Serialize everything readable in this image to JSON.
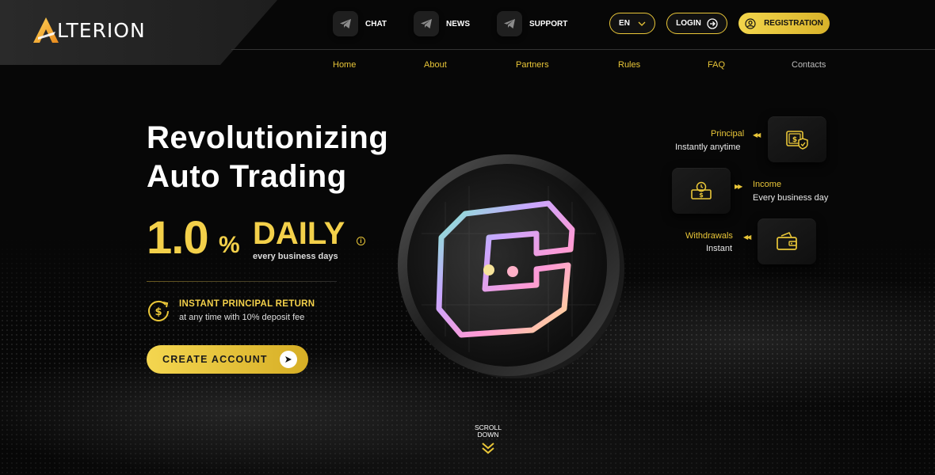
{
  "brand": {
    "name": "LTERION",
    "logo_letter": "A"
  },
  "topbar": {
    "links": [
      {
        "label": "CHAT",
        "icon": "telegram-icon"
      },
      {
        "label": "NEWS",
        "icon": "telegram-icon"
      },
      {
        "label": "SUPPORT",
        "icon": "telegram-icon"
      }
    ],
    "language": "EN",
    "login": "LOGIN",
    "registration": "REGISTRATION"
  },
  "nav": {
    "items": [
      "Home",
      "About",
      "Partners",
      "Rules",
      "FAQ",
      "Contacts"
    ]
  },
  "hero": {
    "title_line1": "Revolutionizing",
    "title_line2": "Auto Trading",
    "rate_value": "1.0",
    "rate_unit": "%",
    "rate_period": "DAILY",
    "rate_sub": "every business days",
    "instant_title": "INSTANT PRINCIPAL RETURN",
    "instant_sub": "at any time with 10% deposit fee",
    "cta": "CREATE ACCOUNT"
  },
  "features": [
    {
      "title": "Principal",
      "sub": "Instantly anytime",
      "icon": "money-shield-icon"
    },
    {
      "title": "Income",
      "sub": "Every business day",
      "icon": "money-clock-icon"
    },
    {
      "title": "Withdrawals",
      "sub": "Instant",
      "icon": "wallet-icon"
    }
  ],
  "scroll": {
    "line1": "SCROLL",
    "line2": "DOWN"
  },
  "colors": {
    "accent": "#e9c638",
    "background": "#070707"
  }
}
